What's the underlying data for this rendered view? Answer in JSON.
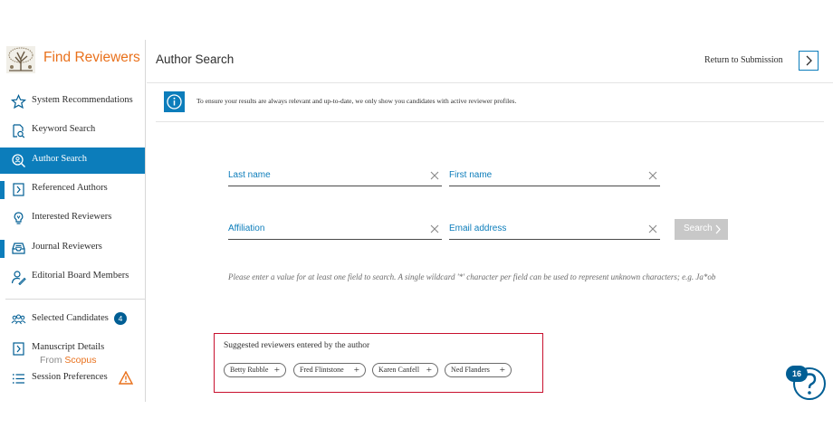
{
  "app": {
    "title": "Find Reviewers"
  },
  "colors": {
    "accent": "#0c7dbb",
    "brand": "#e9711c",
    "highlight_border": "#c8102e"
  },
  "sidebar": {
    "items": [
      {
        "label": "System Recommendations",
        "icon": "star-icon"
      },
      {
        "label": "Keyword Search",
        "icon": "document-search-icon"
      },
      {
        "label": "Author Search",
        "icon": "magnifier-icon",
        "active": true
      },
      {
        "label": "Referenced Authors",
        "icon": "document-arrow-icon",
        "beta": true
      },
      {
        "label": "Interested Reviewers",
        "icon": "lightbulb-icon"
      },
      {
        "label": "Journal Reviewers",
        "icon": "inbox-icon",
        "beta": true
      },
      {
        "label": "Editorial Board Members",
        "icon": "person-edit-icon"
      },
      {
        "label": "Selected Candidates",
        "icon": "group-icon",
        "badge": "4"
      },
      {
        "label": "Manuscript Details",
        "icon": "document-arrow-icon"
      },
      {
        "label": "Session Preferences",
        "icon": "list-icon",
        "warning": true
      }
    ],
    "footer": {
      "prefix": "From",
      "brand": "Scopus"
    }
  },
  "header": {
    "title": "Author Search",
    "return_label": "Return to Submission"
  },
  "info": {
    "text": "To ensure your results are always relevant and up-to-date, we only show you candidates with active reviewer profiles."
  },
  "form": {
    "last_name": {
      "placeholder": "Last name",
      "value": ""
    },
    "first_name": {
      "placeholder": "First name",
      "value": ""
    },
    "affiliation": {
      "placeholder": "Affiliation",
      "value": ""
    },
    "email": {
      "placeholder": "Email address",
      "value": ""
    },
    "search_label": "Search",
    "hint": "Please enter a value for at least one field to search. A single wildcard '*' character per field can be used to represent unknown characters; e.g. Ja*ob"
  },
  "suggested": {
    "title": "Suggested reviewers entered by the author",
    "reviewers": [
      "Betty Rubble",
      "Fred Flintstone",
      "Karen Canfell",
      "Ned Flanders"
    ]
  },
  "help": {
    "count": "16"
  }
}
